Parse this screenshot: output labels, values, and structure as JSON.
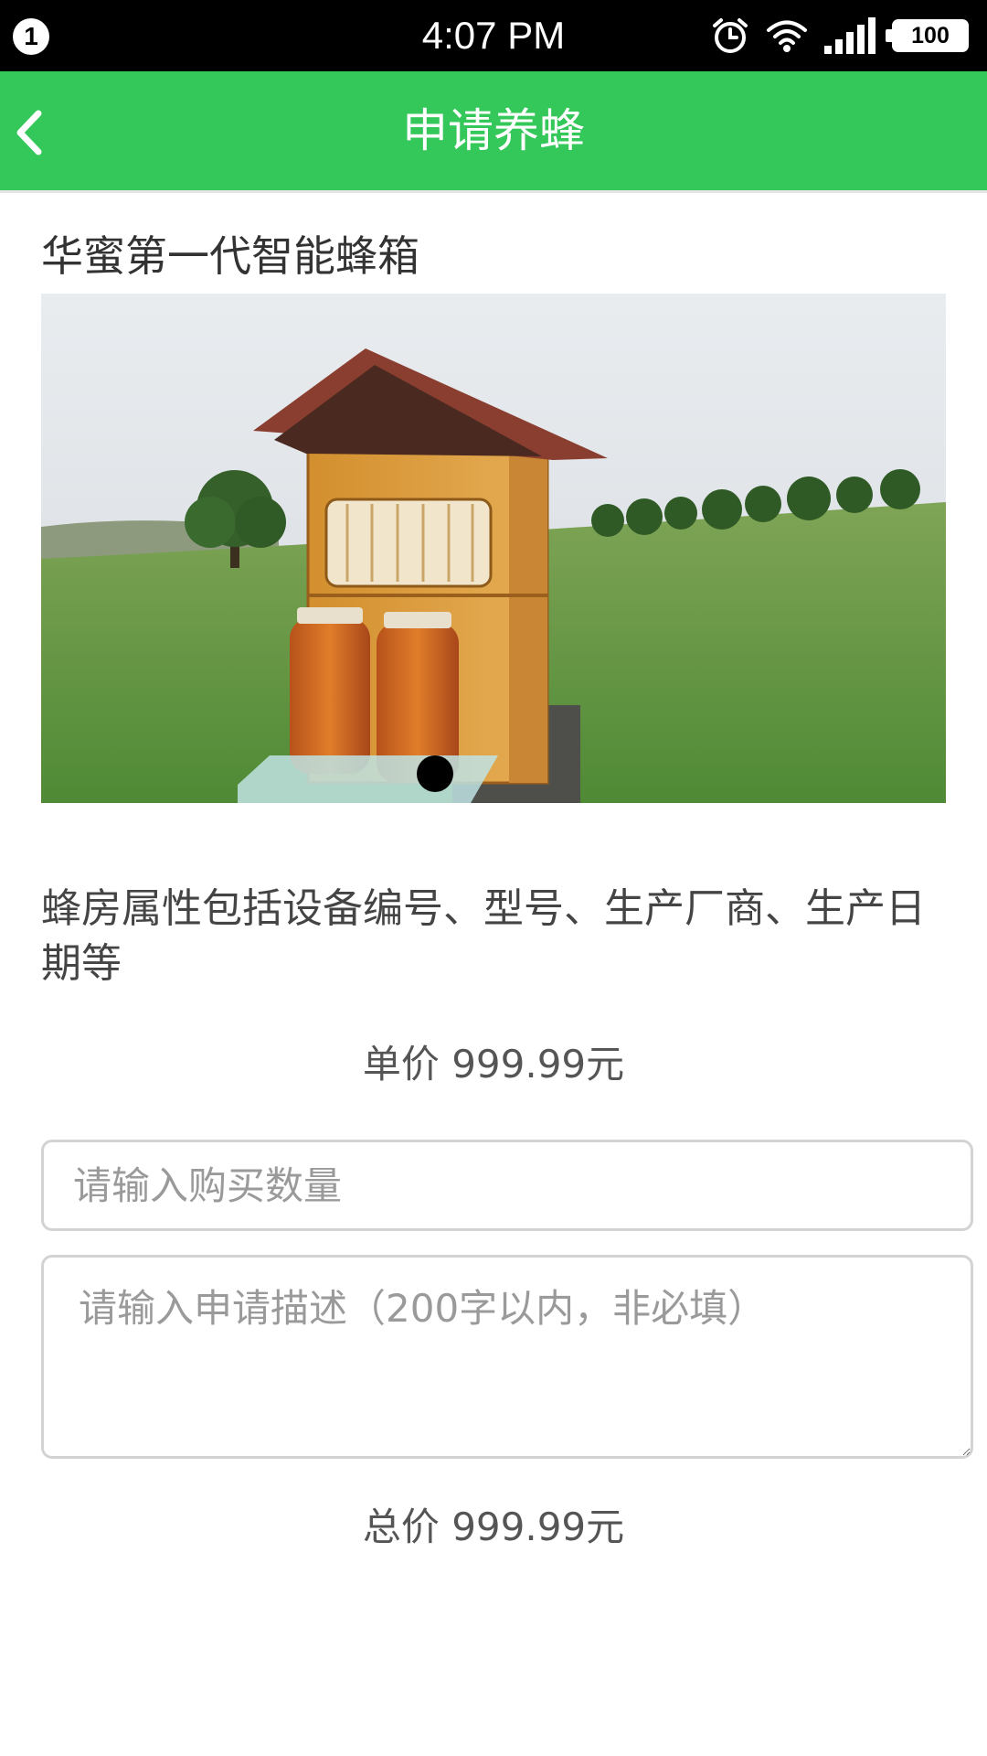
{
  "status_bar": {
    "notification_count": "1",
    "time": "4:07 PM",
    "icons": [
      "alarm-icon",
      "wifi-icon",
      "signal-icon",
      "battery-icon"
    ],
    "battery": "100"
  },
  "app_bar": {
    "title": "申请养蜂",
    "back_icon": "chevron-left-icon",
    "color": "#34c75a"
  },
  "product": {
    "title": "华蜜第一代智能蜂箱",
    "image": "beehive-photo",
    "carousel_active_index": 0,
    "description": "蜂房属性包括设备编号、型号、生产厂商、生产日期等",
    "unit_price": "单价 999.99元"
  },
  "form": {
    "quantity_placeholder": "请输入购买数量",
    "quantity_value": "",
    "description_placeholder": "请输入申请描述（200字以内，非必填）",
    "description_value": ""
  },
  "total_price": "总价 999.99元"
}
